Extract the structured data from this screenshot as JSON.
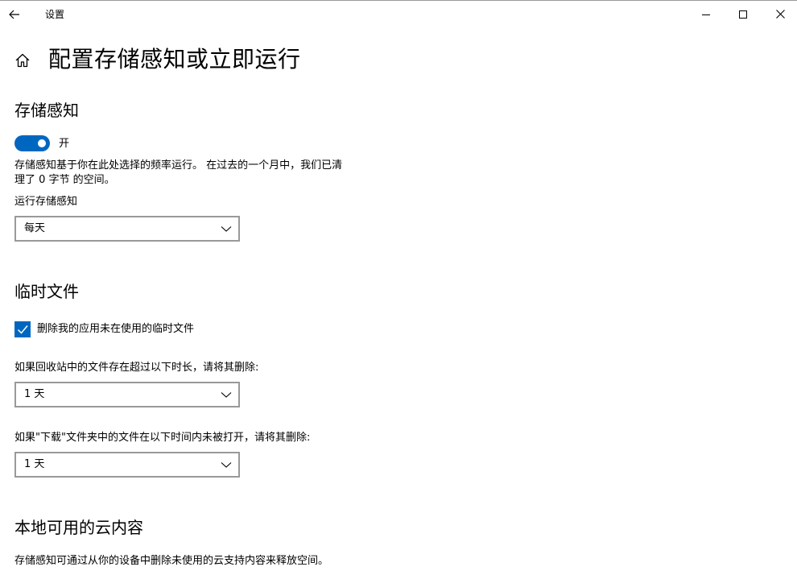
{
  "window": {
    "app_title": "设置"
  },
  "header": {
    "title": "配置存储感知或立即运行"
  },
  "storage_sense": {
    "section_title": "存储感知",
    "toggle_state": "开",
    "toggle_on": true,
    "description_line1": "存储感知基于你在此处选择的频率运行。 在过去的一个月中，我们已清",
    "description_line2": "理了 0 字节 的空间。",
    "run_label": "运行存储感知",
    "run_value": "每天"
  },
  "temp_files": {
    "section_title": "临时文件",
    "checkbox_label": "删除我的应用未在使用的临时文件",
    "checkbox_checked": true,
    "recycle_label": "如果回收站中的文件存在超过以下时长，请将其删除:",
    "recycle_value": "1 天",
    "downloads_label": "如果\"下载\"文件夹中的文件在以下时间内未被打开，请将其删除:",
    "downloads_value": "1 天"
  },
  "cloud_content": {
    "section_title": "本地可用的云内容",
    "description": "存储感知可通过从你的设备中删除未使用的云支持内容来释放空间。"
  },
  "colors": {
    "accent": "#0067c0",
    "border": "#999999",
    "text": "#000000"
  },
  "icons": {
    "back": "back-arrow-icon",
    "minimize": "minimize-icon",
    "maximize": "maximize-icon",
    "close": "close-icon",
    "home": "home-icon",
    "chevron": "chevron-down-icon",
    "check": "checkmark-icon"
  }
}
